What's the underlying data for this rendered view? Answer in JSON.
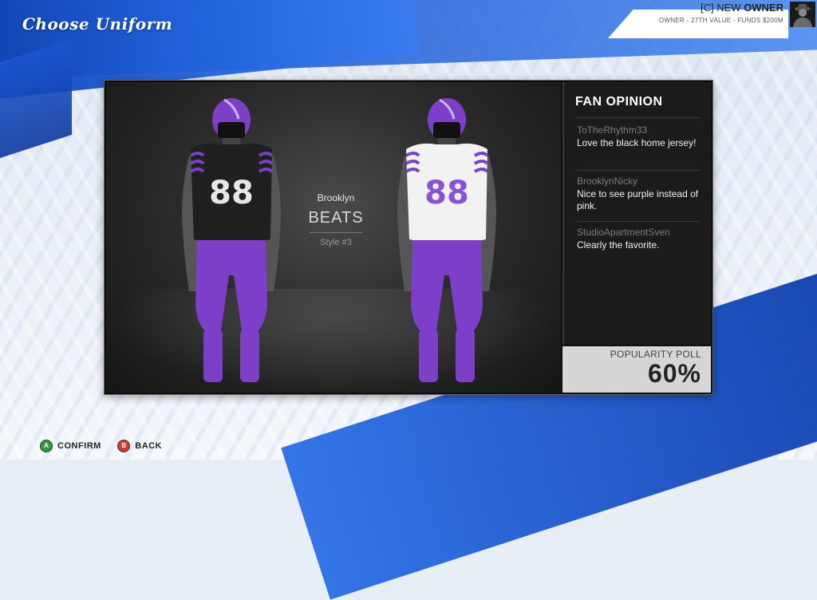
{
  "screen": {
    "title": "Choose Uniform"
  },
  "owner": {
    "tag": "[C] NEW",
    "role": "OWNER",
    "subtitle": "OWNER - 27TH VALUE - FUNDS $200M",
    "avatar_icon": "owner-silhouette-icon"
  },
  "team": {
    "city": "Brooklyn",
    "name": "BEATS",
    "style": "Style #3"
  },
  "uniforms": [
    {
      "side": "home",
      "jersey_number": "88",
      "jersey_color": "#1f1f1f",
      "number_color": "#e8e8e8",
      "pants_color": "#7d3fc8",
      "helmet_color": "#7d3fc8"
    },
    {
      "side": "away",
      "jersey_number": "88",
      "jersey_color": "#f2f2f2",
      "number_color": "#8a52d4",
      "pants_color": "#7d3fc8",
      "helmet_color": "#7d3fc8"
    }
  ],
  "fan_opinion": {
    "title": "FAN OPINION",
    "comments": [
      {
        "user": "ToTheRhythm33",
        "text": "Love the black home jersey!"
      },
      {
        "user": "BrooklynNicky",
        "text": "Nice to see purple instead of pink."
      },
      {
        "user": "StudioApartmentSven",
        "text": "Clearly the favorite."
      }
    ]
  },
  "poll": {
    "label": "POPULARITY POLL",
    "value": "60%"
  },
  "controls": [
    {
      "button": "A",
      "label": "CONFIRM",
      "color": "#2f9e3a"
    },
    {
      "button": "B",
      "label": "BACK",
      "color": "#d43a2d"
    }
  ]
}
